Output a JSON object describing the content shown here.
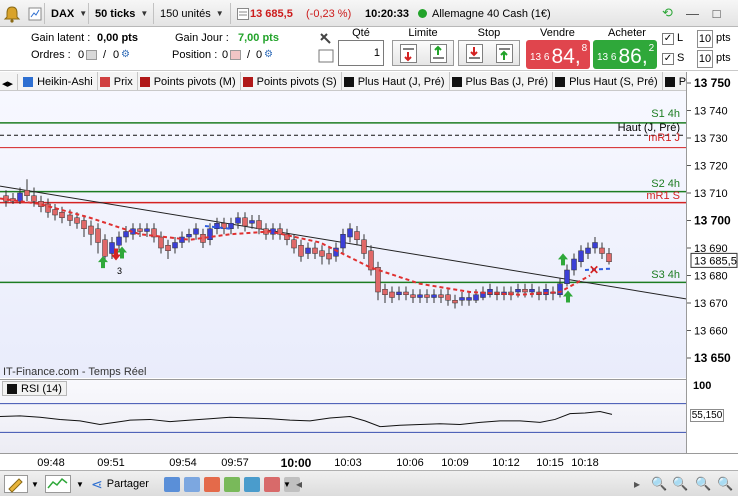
{
  "toolbar": {
    "symbol": "DAX",
    "interval": "50 ticks",
    "units": "150 unités",
    "last_price": "13 685,5",
    "change": "(-0,23 %)",
    "time": "10:20:33",
    "market": "Allemagne 40 Cash (1€)"
  },
  "panel": {
    "gain_latent_label": "Gain latent :",
    "gain_latent_value": "0,00 pts",
    "ordres_label": "Ordres :",
    "ordres_value": "0",
    "ordres_value2": "0",
    "gain_jour_label": "Gain Jour :",
    "gain_jour_value": "7,00 pts",
    "position_label": "Position :",
    "position_value": "0",
    "position_value2": "0",
    "qty_label": "Qté",
    "qty_value": "1",
    "limite_label": "Limite",
    "stop_label": "Stop",
    "vendre_label": "Vendre",
    "vendre_prefix": "13 6",
    "vendre_big": "84,",
    "vendre_sup": "8",
    "acheter_label": "Acheter",
    "acheter_prefix": "13 6",
    "acheter_big": "86,",
    "acheter_sup": "2",
    "l_label": "L",
    "l_value": "10",
    "l_unit": "pts",
    "s_label": "S",
    "s_value": "10",
    "s_unit": "pts"
  },
  "tabs": [
    {
      "label": "Heikin-Ashi",
      "color": "#2e6fd1"
    },
    {
      "label": "Prix",
      "color": "#d04040"
    },
    {
      "label": "Points pivots (M)",
      "color": "#b01818"
    },
    {
      "label": "Points pivots (S)",
      "color": "#b01818"
    },
    {
      "label": "Plus Haut (J, Pré)",
      "color": "#111111"
    },
    {
      "label": "Plus Bas (J, Pré)",
      "color": "#111111"
    },
    {
      "label": "Plus Haut (S, Pré)",
      "color": "#111111"
    },
    {
      "label": "Plu",
      "color": "#111111"
    }
  ],
  "levels": {
    "s1": "S1 4h",
    "haut": "Haut (J, Pré)",
    "mr1j": "mR1 J",
    "s2": "S2 4h",
    "mr1s": "mR1 S",
    "s3": "S3 4h"
  },
  "yaxis": [
    "13 750",
    "13 740",
    "13 730",
    "13 720",
    "13 710",
    "13 700",
    "13 690",
    "13 680",
    "13 670",
    "13 660",
    "13 650"
  ],
  "current_price_label": "13 685,5",
  "watermark": "IT-Finance.com - Temps Réel",
  "signal_count": "3",
  "rsi": {
    "label": "RSI (14)",
    "axis_top": "100",
    "value": "55,150"
  },
  "xaxis": [
    "09:48",
    "09:51",
    "09:54",
    "09:57",
    "10:00",
    "10:03",
    "10:06",
    "10:09",
    "10:12",
    "10:15",
    "10:18"
  ],
  "bottom": {
    "share_label": "Partager"
  },
  "colors": {
    "sell": "#e0454d",
    "buy": "#2fa83a",
    "candle_up": "#3b3fd6",
    "candle_down": "#e06868",
    "support": "#1d7d22",
    "resistance": "#d42222"
  }
}
